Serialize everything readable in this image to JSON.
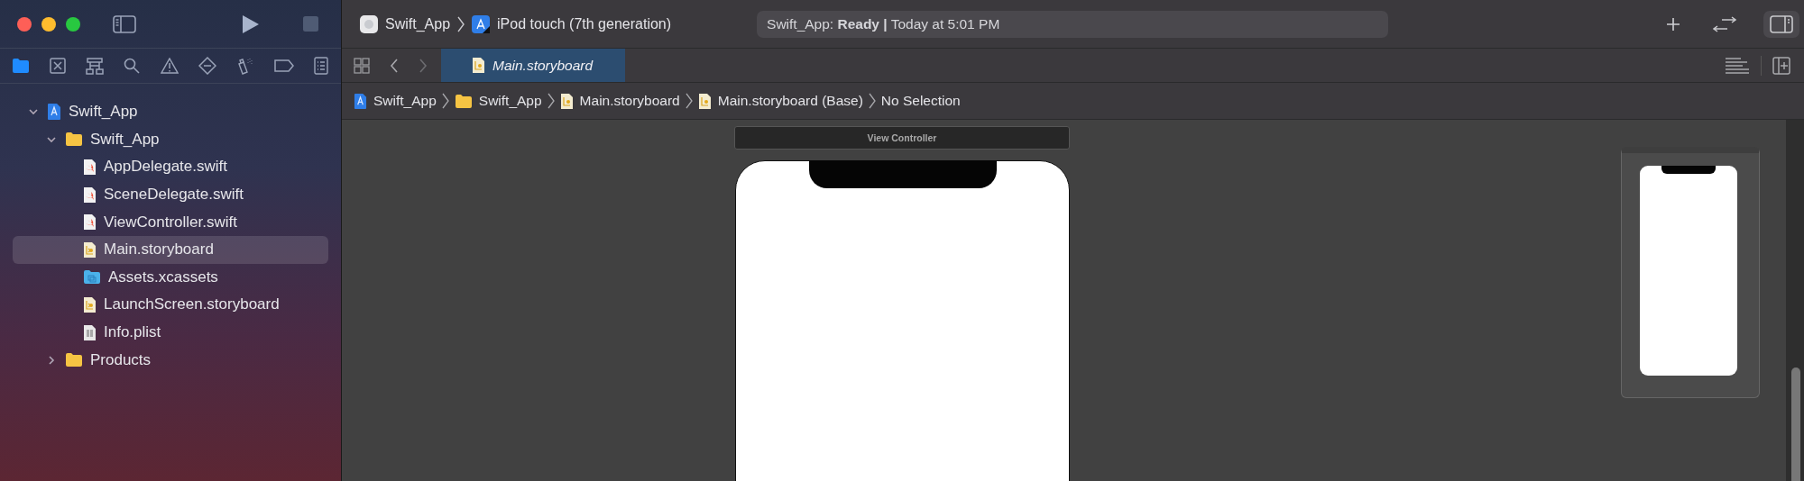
{
  "toolbar": {
    "scheme": "Swift_App",
    "device": "iPod touch (7th generation)",
    "status": "Swift_App: **Ready |** Today at 5:01 PM"
  },
  "navigator_tabs": [
    {
      "kind": "folder",
      "selected": true
    },
    {
      "kind": "source-control",
      "selected": false
    },
    {
      "kind": "hierarchy",
      "selected": false
    },
    {
      "kind": "search",
      "selected": false
    },
    {
      "kind": "warning",
      "selected": false
    },
    {
      "kind": "test",
      "selected": false
    },
    {
      "kind": "debug",
      "selected": false
    },
    {
      "kind": "breakpoint",
      "selected": false
    },
    {
      "kind": "report",
      "selected": false
    }
  ],
  "tree": [
    {
      "label": "Swift_App",
      "kind": "project",
      "expanded": true,
      "selected": false,
      "children": [
        {
          "label": "Swift_App",
          "kind": "folder",
          "expanded": true,
          "selected": false,
          "children": [
            {
              "label": "AppDelegate.swift",
              "kind": "swift",
              "selected": false
            },
            {
              "label": "SceneDelegate.swift",
              "kind": "swift",
              "selected": false
            },
            {
              "label": "ViewController.swift",
              "kind": "swift",
              "selected": false
            },
            {
              "label": "Main.storyboard",
              "kind": "storyboard",
              "selected": true
            },
            {
              "label": "Assets.xcassets",
              "kind": "assets",
              "selected": false
            },
            {
              "label": "LaunchScreen.storyboard",
              "kind": "storyboard",
              "selected": false
            },
            {
              "label": "Info.plist",
              "kind": "plist",
              "selected": false
            }
          ]
        },
        {
          "label": "Products",
          "kind": "folder",
          "expanded": false,
          "selected": false
        }
      ]
    }
  ],
  "tabs": [
    {
      "label": "Main.storyboard",
      "selected": true
    }
  ],
  "breadcrumb": [
    {
      "label": "Swift_App",
      "kind": "project"
    },
    {
      "label": "Swift_App",
      "kind": "folder"
    },
    {
      "label": "Main.storyboard",
      "kind": "storyboard"
    },
    {
      "label": "Main.storyboard (Base)",
      "kind": "storyboard"
    },
    {
      "label": "No Selection",
      "kind": "none"
    }
  ],
  "canvas": {
    "scene_title": "View Controller"
  }
}
